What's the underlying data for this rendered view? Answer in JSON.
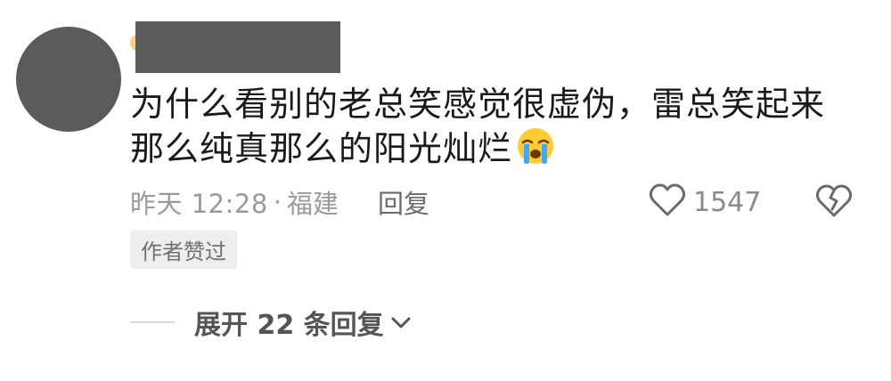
{
  "comment": {
    "text_line1": "为什么看别的老总笑感觉很虚伪，雷总笑起来",
    "text_line2": "那么纯真那么的阳光灿烂",
    "emoji": "crying-face-icon",
    "time": "昨天 12:28",
    "separator": "·",
    "location": "福建",
    "reply_label": "回复",
    "like_count": "1547",
    "author_badge": "作者赞过"
  },
  "replies": {
    "expand_label": "展开 22 条回复"
  },
  "colors": {
    "redaction": "#5b5b5b",
    "text": "#1a1a1a",
    "meta": "#9a9a9a",
    "badge_bg": "#eeeeee"
  }
}
